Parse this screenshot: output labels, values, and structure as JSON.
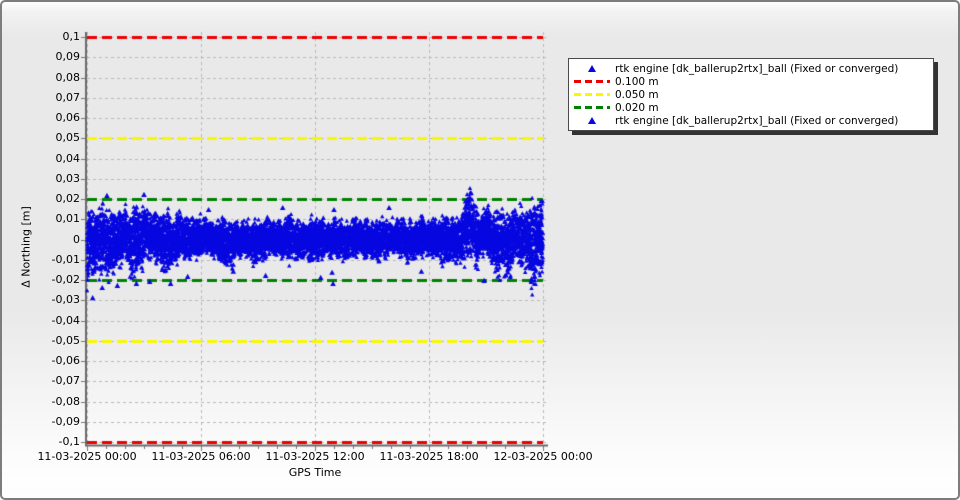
{
  "palette": {
    "background": "#e9e9e9",
    "grid": "#b9b9b9",
    "axis": "#6a6a6a",
    "legend_background": "#ffffff",
    "legend_shadow": "#333333",
    "marker_blue": "#0606e0",
    "threshold_red": "#ee0000",
    "threshold_yellow": "#f8f800",
    "threshold_green": "#008000"
  },
  "legend": {
    "entries": [
      {
        "marker": "triangle",
        "color": "#0606e0",
        "label": "rtk engine [dk_ballerup2rtx]_ball (Fixed or converged)"
      },
      {
        "marker": "dash",
        "color": "#ee0000",
        "label": "0.100 m"
      },
      {
        "marker": "dash",
        "color": "#f8f800",
        "label": "0.050 m"
      },
      {
        "marker": "dash",
        "color": "#008000",
        "label": "0.020 m"
      },
      {
        "marker": "triangle",
        "color": "#0606e0",
        "label": "rtk engine [dk_ballerup2rtx]_ball (Fixed or converged)"
      }
    ]
  },
  "chart_data": {
    "type": "scatter",
    "title": "",
    "xlabel": "GPS Time",
    "ylabel": "Δ Northing [m]",
    "ylim": [
      -0.1,
      0.1
    ],
    "x_range": [
      "11-03-2025 00:00",
      "12-03-2025 00:00"
    ],
    "grid": true,
    "legend_position": "top-right",
    "y_ticks": [
      {
        "v": 0.1,
        "label": "0,1"
      },
      {
        "v": 0.09,
        "label": "0,09"
      },
      {
        "v": 0.08,
        "label": "0,08"
      },
      {
        "v": 0.07,
        "label": "0,07"
      },
      {
        "v": 0.06,
        "label": "0,06"
      },
      {
        "v": 0.05,
        "label": "0,05"
      },
      {
        "v": 0.04,
        "label": "0,04"
      },
      {
        "v": 0.03,
        "label": "0,03"
      },
      {
        "v": 0.02,
        "label": "0,02"
      },
      {
        "v": 0.01,
        "label": "0,01"
      },
      {
        "v": 0.0,
        "label": "0"
      },
      {
        "v": -0.01,
        "label": "-0,01"
      },
      {
        "v": -0.02,
        "label": "-0,02"
      },
      {
        "v": -0.03,
        "label": "-0,03"
      },
      {
        "v": -0.04,
        "label": "-0,04"
      },
      {
        "v": -0.05,
        "label": "-0,05"
      },
      {
        "v": -0.06,
        "label": "-0,06"
      },
      {
        "v": -0.07,
        "label": "-0,07"
      },
      {
        "v": -0.08,
        "label": "-0,08"
      },
      {
        "v": -0.09,
        "label": "-0,09"
      },
      {
        "v": -0.1,
        "label": "-0,1"
      }
    ],
    "x_ticks": [
      {
        "hour": 0,
        "label": "11-03-2025 00:00"
      },
      {
        "hour": 6,
        "label": "11-03-2025 06:00"
      },
      {
        "hour": 12,
        "label": "11-03-2025 12:00"
      },
      {
        "hour": 18,
        "label": "11-03-2025 18:00"
      },
      {
        "hour": 24,
        "label": "12-03-2025 00:00"
      }
    ],
    "x_minor_tick_every_hours": 1,
    "reference_lines": [
      {
        "label": "0.100 m",
        "color": "#ee0000",
        "values": [
          0.1,
          -0.1
        ]
      },
      {
        "label": "0.050 m",
        "color": "#f8f800",
        "values": [
          0.05,
          -0.05
        ]
      },
      {
        "label": "0.020 m",
        "color": "#008000",
        "values": [
          0.02,
          -0.02
        ]
      }
    ],
    "series": [
      {
        "name": "rtk engine [dk_ballerup2rtx]_ball (Fixed or converged)",
        "marker": "triangle",
        "color": "#0606e0",
        "band_envelope_m": [
          [
            0.0,
            -0.03,
            0.018
          ],
          [
            0.15,
            -0.026,
            0.02
          ],
          [
            0.5,
            -0.022,
            0.019
          ],
          [
            0.9,
            -0.02,
            0.021
          ],
          [
            1.3,
            -0.024,
            0.018
          ],
          [
            2.0,
            -0.016,
            0.021
          ],
          [
            2.4,
            -0.023,
            0.018
          ],
          [
            2.9,
            -0.017,
            0.021
          ],
          [
            3.5,
            -0.014,
            0.019
          ],
          [
            4.2,
            -0.021,
            0.017
          ],
          [
            4.8,
            -0.014,
            0.015
          ],
          [
            5.5,
            -0.012,
            0.014
          ],
          [
            6.5,
            -0.011,
            0.012
          ],
          [
            7.5,
            -0.017,
            0.013
          ],
          [
            8.2,
            -0.011,
            0.012
          ],
          [
            9.0,
            -0.015,
            0.013
          ],
          [
            9.8,
            -0.011,
            0.012
          ],
          [
            10.8,
            -0.013,
            0.014
          ],
          [
            11.6,
            -0.015,
            0.012
          ],
          [
            12.4,
            -0.011,
            0.013
          ],
          [
            13.2,
            -0.013,
            0.011
          ],
          [
            14.0,
            -0.011,
            0.013
          ],
          [
            15.0,
            -0.013,
            0.012
          ],
          [
            16.0,
            -0.011,
            0.013
          ],
          [
            17.0,
            -0.013,
            0.012
          ],
          [
            18.0,
            -0.011,
            0.013
          ],
          [
            18.8,
            -0.014,
            0.013
          ],
          [
            19.6,
            -0.017,
            0.015
          ],
          [
            20.0,
            -0.014,
            0.026
          ],
          [
            20.3,
            -0.015,
            0.028
          ],
          [
            20.6,
            -0.016,
            0.017
          ],
          [
            21.0,
            -0.013,
            0.02
          ],
          [
            21.5,
            -0.019,
            0.017
          ],
          [
            21.9,
            -0.021,
            0.021
          ],
          [
            22.15,
            -0.031,
            0.018
          ],
          [
            22.4,
            -0.017,
            0.019
          ],
          [
            22.9,
            -0.019,
            0.022
          ],
          [
            23.3,
            -0.024,
            0.02
          ],
          [
            23.6,
            -0.03,
            0.024
          ],
          [
            23.85,
            -0.026,
            0.031
          ],
          [
            24.0,
            -0.029,
            0.029
          ]
        ],
        "outlier_points_m": [
          [
            0.3,
            -0.029
          ],
          [
            0.8,
            -0.024
          ],
          [
            1.05,
            0.0215
          ],
          [
            1.6,
            -0.023
          ],
          [
            2.6,
            -0.022
          ],
          [
            3.0,
            0.022
          ],
          [
            3.3,
            -0.021
          ],
          [
            4.4,
            -0.022
          ],
          [
            5.3,
            -0.0185
          ],
          [
            6.4,
            0.0145
          ],
          [
            7.7,
            -0.016
          ],
          [
            9.4,
            -0.018
          ],
          [
            10.3,
            0.0155
          ],
          [
            12.3,
            -0.019
          ],
          [
            12.9,
            -0.0165
          ],
          [
            12.95,
            -0.022
          ],
          [
            13.0,
            0.0145
          ],
          [
            15.9,
            0.0155
          ],
          [
            17.6,
            -0.016
          ],
          [
            20.9,
            -0.0205
          ]
        ]
      }
    ]
  }
}
